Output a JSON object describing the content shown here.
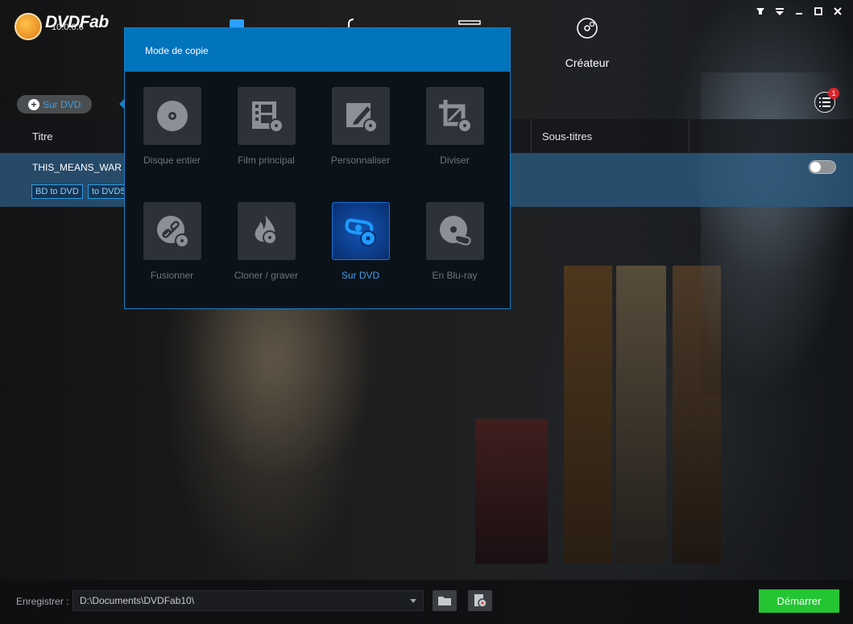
{
  "app": {
    "name": "DVDFab",
    "version": "10.0.0.6"
  },
  "tabs": [
    {
      "label": ""
    },
    {
      "label": ""
    },
    {
      "label": ""
    },
    {
      "label": "Créateur",
      "icon": "disc-creator-icon"
    }
  ],
  "window_controls": [
    "pin-icon",
    "menu-icon",
    "minimize-icon",
    "maximize-icon",
    "close-icon"
  ],
  "mode_pill": {
    "label": "Sur DVD"
  },
  "queue": {
    "badge": "1"
  },
  "table": {
    "columns": [
      "Titre",
      "Sous-titres"
    ],
    "rows": [
      {
        "title": "THIS_MEANS_WAR",
        "tags": [
          "BD to DVD",
          "to DVD5"
        ]
      }
    ]
  },
  "popup": {
    "title": "Mode de copie",
    "modes": [
      {
        "label": "Disque entier",
        "icon": "disc-icon"
      },
      {
        "label": "Film principal",
        "icon": "film-icon"
      },
      {
        "label": "Personnaliser",
        "icon": "edit-icon"
      },
      {
        "label": "Diviser",
        "icon": "crop-icon"
      },
      {
        "label": "Fusionner",
        "icon": "link-icon"
      },
      {
        "label": "Cloner / graver",
        "icon": "flame-icon"
      },
      {
        "label": "Sur DVD",
        "icon": "bluray-to-dvd-icon",
        "selected": true
      },
      {
        "label": "En Blu-ray",
        "icon": "dvd-to-bluray-icon"
      }
    ]
  },
  "bottom": {
    "save_label": "Enregistrer :",
    "path": "D:\\Documents\\DVDFab10\\",
    "start_label": "Démarrer"
  },
  "colors": {
    "accent": "#0273bd",
    "start": "#24c532",
    "selected_text": "#3f9ee8"
  }
}
